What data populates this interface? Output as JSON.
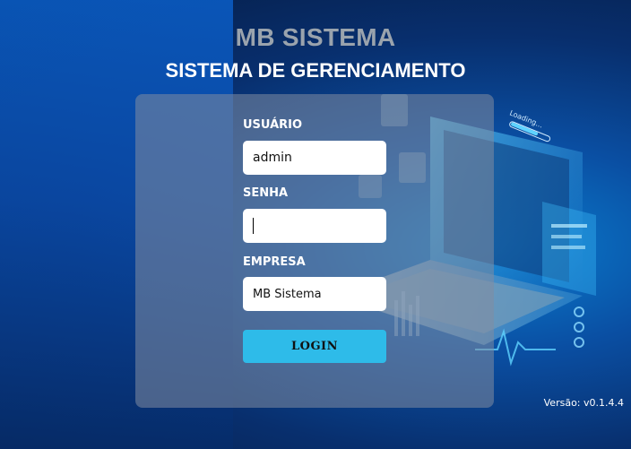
{
  "header": {
    "app_name": "MB SISTEMA",
    "subtitle": "SISTEMA DE GERENCIAMENTO"
  },
  "form": {
    "user_label": "USUÁRIO",
    "user_value": "admin",
    "password_label": "SENHA",
    "password_value": "",
    "company_label": "EMPRESA",
    "company_value": "MB Sistema",
    "login_label": "LOGIN"
  },
  "illustration": {
    "loading_text": "Loading..."
  },
  "footer": {
    "version": "Versão: v0.1.4.4"
  },
  "colors": {
    "accent": "#2ebbe9",
    "panel": "#8290a0",
    "background": "#0a4aa8"
  }
}
